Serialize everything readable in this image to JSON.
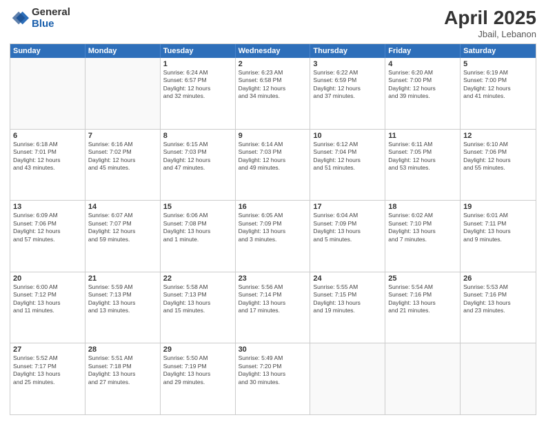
{
  "logo": {
    "general": "General",
    "blue": "Blue"
  },
  "title": {
    "month_year": "April 2025",
    "location": "Jbail, Lebanon"
  },
  "header_days": [
    "Sunday",
    "Monday",
    "Tuesday",
    "Wednesday",
    "Thursday",
    "Friday",
    "Saturday"
  ],
  "weeks": [
    [
      {
        "day": "",
        "empty": true
      },
      {
        "day": "",
        "empty": true
      },
      {
        "day": "1",
        "lines": [
          "Sunrise: 6:24 AM",
          "Sunset: 6:57 PM",
          "Daylight: 12 hours",
          "and 32 minutes."
        ]
      },
      {
        "day": "2",
        "lines": [
          "Sunrise: 6:23 AM",
          "Sunset: 6:58 PM",
          "Daylight: 12 hours",
          "and 34 minutes."
        ]
      },
      {
        "day": "3",
        "lines": [
          "Sunrise: 6:22 AM",
          "Sunset: 6:59 PM",
          "Daylight: 12 hours",
          "and 37 minutes."
        ]
      },
      {
        "day": "4",
        "lines": [
          "Sunrise: 6:20 AM",
          "Sunset: 7:00 PM",
          "Daylight: 12 hours",
          "and 39 minutes."
        ]
      },
      {
        "day": "5",
        "lines": [
          "Sunrise: 6:19 AM",
          "Sunset: 7:00 PM",
          "Daylight: 12 hours",
          "and 41 minutes."
        ]
      }
    ],
    [
      {
        "day": "6",
        "lines": [
          "Sunrise: 6:18 AM",
          "Sunset: 7:01 PM",
          "Daylight: 12 hours",
          "and 43 minutes."
        ]
      },
      {
        "day": "7",
        "lines": [
          "Sunrise: 6:16 AM",
          "Sunset: 7:02 PM",
          "Daylight: 12 hours",
          "and 45 minutes."
        ]
      },
      {
        "day": "8",
        "lines": [
          "Sunrise: 6:15 AM",
          "Sunset: 7:03 PM",
          "Daylight: 12 hours",
          "and 47 minutes."
        ]
      },
      {
        "day": "9",
        "lines": [
          "Sunrise: 6:14 AM",
          "Sunset: 7:03 PM",
          "Daylight: 12 hours",
          "and 49 minutes."
        ]
      },
      {
        "day": "10",
        "lines": [
          "Sunrise: 6:12 AM",
          "Sunset: 7:04 PM",
          "Daylight: 12 hours",
          "and 51 minutes."
        ]
      },
      {
        "day": "11",
        "lines": [
          "Sunrise: 6:11 AM",
          "Sunset: 7:05 PM",
          "Daylight: 12 hours",
          "and 53 minutes."
        ]
      },
      {
        "day": "12",
        "lines": [
          "Sunrise: 6:10 AM",
          "Sunset: 7:06 PM",
          "Daylight: 12 hours",
          "and 55 minutes."
        ]
      }
    ],
    [
      {
        "day": "13",
        "lines": [
          "Sunrise: 6:09 AM",
          "Sunset: 7:06 PM",
          "Daylight: 12 hours",
          "and 57 minutes."
        ]
      },
      {
        "day": "14",
        "lines": [
          "Sunrise: 6:07 AM",
          "Sunset: 7:07 PM",
          "Daylight: 12 hours",
          "and 59 minutes."
        ]
      },
      {
        "day": "15",
        "lines": [
          "Sunrise: 6:06 AM",
          "Sunset: 7:08 PM",
          "Daylight: 13 hours",
          "and 1 minute."
        ]
      },
      {
        "day": "16",
        "lines": [
          "Sunrise: 6:05 AM",
          "Sunset: 7:09 PM",
          "Daylight: 13 hours",
          "and 3 minutes."
        ]
      },
      {
        "day": "17",
        "lines": [
          "Sunrise: 6:04 AM",
          "Sunset: 7:09 PM",
          "Daylight: 13 hours",
          "and 5 minutes."
        ]
      },
      {
        "day": "18",
        "lines": [
          "Sunrise: 6:02 AM",
          "Sunset: 7:10 PM",
          "Daylight: 13 hours",
          "and 7 minutes."
        ]
      },
      {
        "day": "19",
        "lines": [
          "Sunrise: 6:01 AM",
          "Sunset: 7:11 PM",
          "Daylight: 13 hours",
          "and 9 minutes."
        ]
      }
    ],
    [
      {
        "day": "20",
        "lines": [
          "Sunrise: 6:00 AM",
          "Sunset: 7:12 PM",
          "Daylight: 13 hours",
          "and 11 minutes."
        ]
      },
      {
        "day": "21",
        "lines": [
          "Sunrise: 5:59 AM",
          "Sunset: 7:13 PM",
          "Daylight: 13 hours",
          "and 13 minutes."
        ]
      },
      {
        "day": "22",
        "lines": [
          "Sunrise: 5:58 AM",
          "Sunset: 7:13 PM",
          "Daylight: 13 hours",
          "and 15 minutes."
        ]
      },
      {
        "day": "23",
        "lines": [
          "Sunrise: 5:56 AM",
          "Sunset: 7:14 PM",
          "Daylight: 13 hours",
          "and 17 minutes."
        ]
      },
      {
        "day": "24",
        "lines": [
          "Sunrise: 5:55 AM",
          "Sunset: 7:15 PM",
          "Daylight: 13 hours",
          "and 19 minutes."
        ]
      },
      {
        "day": "25",
        "lines": [
          "Sunrise: 5:54 AM",
          "Sunset: 7:16 PM",
          "Daylight: 13 hours",
          "and 21 minutes."
        ]
      },
      {
        "day": "26",
        "lines": [
          "Sunrise: 5:53 AM",
          "Sunset: 7:16 PM",
          "Daylight: 13 hours",
          "and 23 minutes."
        ]
      }
    ],
    [
      {
        "day": "27",
        "lines": [
          "Sunrise: 5:52 AM",
          "Sunset: 7:17 PM",
          "Daylight: 13 hours",
          "and 25 minutes."
        ]
      },
      {
        "day": "28",
        "lines": [
          "Sunrise: 5:51 AM",
          "Sunset: 7:18 PM",
          "Daylight: 13 hours",
          "and 27 minutes."
        ]
      },
      {
        "day": "29",
        "lines": [
          "Sunrise: 5:50 AM",
          "Sunset: 7:19 PM",
          "Daylight: 13 hours",
          "and 29 minutes."
        ]
      },
      {
        "day": "30",
        "lines": [
          "Sunrise: 5:49 AM",
          "Sunset: 7:20 PM",
          "Daylight: 13 hours",
          "and 30 minutes."
        ]
      },
      {
        "day": "",
        "empty": true
      },
      {
        "day": "",
        "empty": true
      },
      {
        "day": "",
        "empty": true
      }
    ]
  ]
}
